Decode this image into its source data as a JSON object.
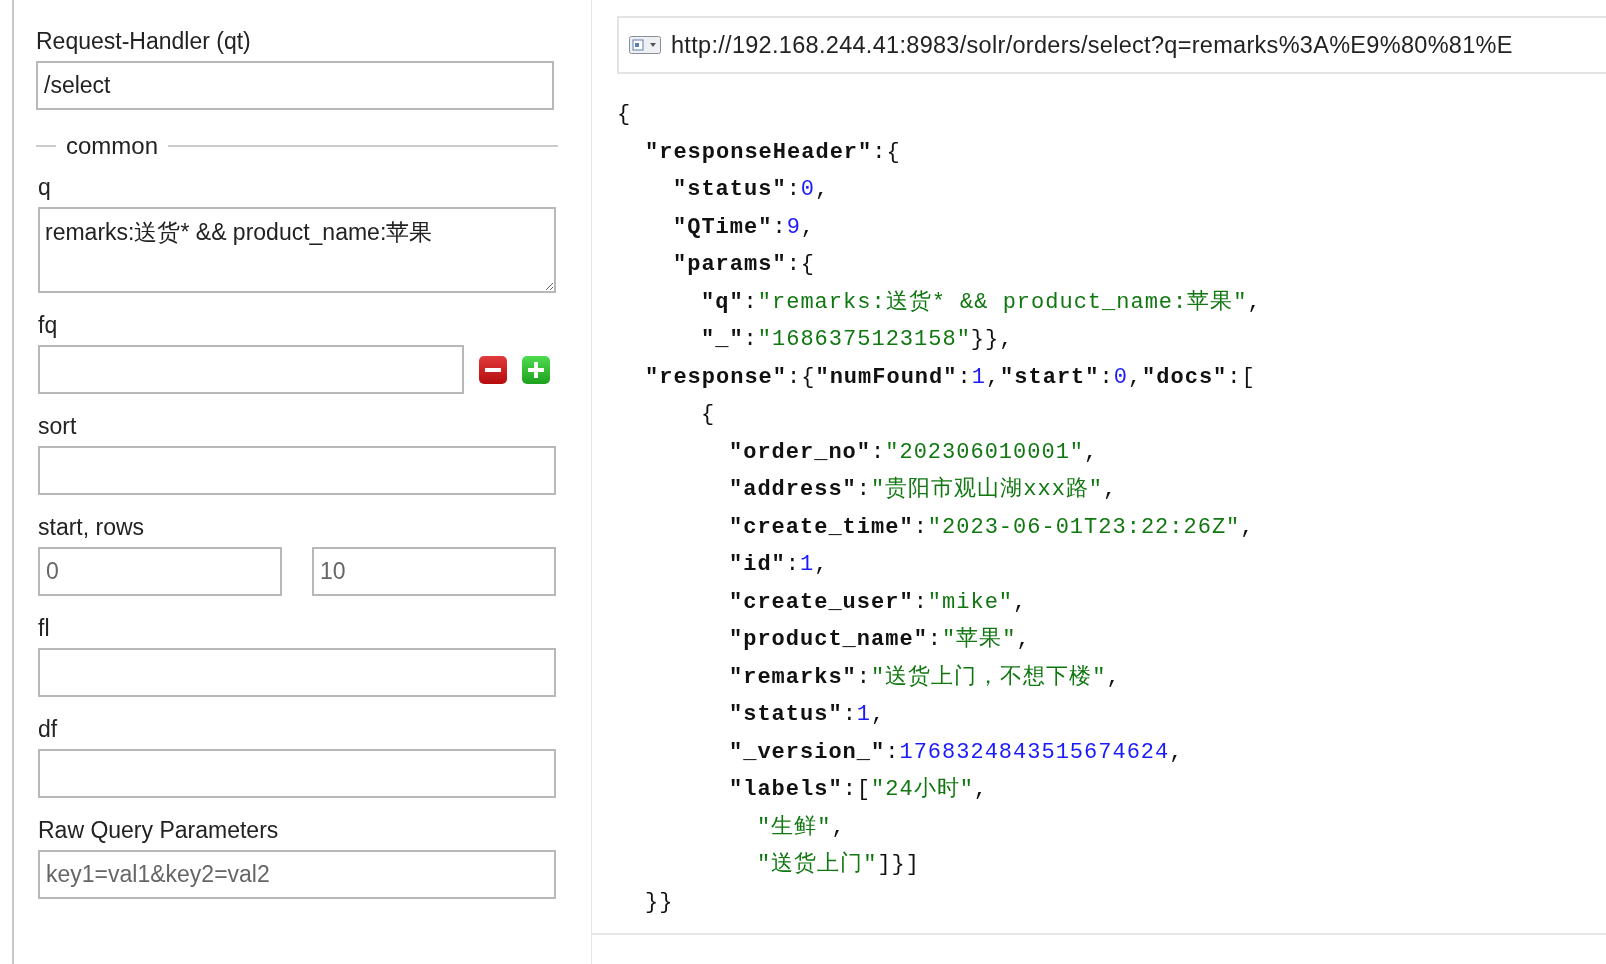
{
  "handler": {
    "label": "Request-Handler (qt)",
    "value": "/select"
  },
  "section": {
    "legend": "common"
  },
  "fields": [
    {
      "kind": "textarea",
      "label": "q",
      "value": "remarks:送货* && product_name:苹果"
    },
    {
      "kind": "filter",
      "label": "fq"
    },
    {
      "kind": "text",
      "label": "sort"
    },
    {
      "kind": "pair",
      "label": "start, rows",
      "placeholders": [
        "0",
        "10"
      ]
    },
    {
      "kind": "text",
      "label": "fl"
    },
    {
      "kind": "text",
      "label": "df"
    },
    {
      "kind": "text",
      "label": "Raw Query Parameters",
      "placeholder": "key1=val1&key2=val2"
    }
  ],
  "url_bar": {
    "url": "http://192.168.244.41:8983/solr/orders/select?q=remarks%3A%E9%80%81%E"
  },
  "response": [
    {
      "tokens": [
        {
          "kind": "punct",
          "text": "{"
        }
      ],
      "children": [
        {
          "tokens": [
            {
              "kind": "key",
              "text": "\"responseHeader\""
            },
            {
              "kind": "punct",
              "text": ":{"
            }
          ],
          "children": [
            {
              "tokens": [
                {
                  "kind": "key",
                  "text": "\"status\""
                },
                {
                  "kind": "punct",
                  "text": ":"
                },
                {
                  "kind": "number",
                  "text": "0"
                },
                {
                  "kind": "punct",
                  "text": ","
                }
              ]
            },
            {
              "tokens": [
                {
                  "kind": "key",
                  "text": "\"QTime\""
                },
                {
                  "kind": "punct",
                  "text": ":"
                },
                {
                  "kind": "number",
                  "text": "9"
                },
                {
                  "kind": "punct",
                  "text": ","
                }
              ]
            },
            {
              "tokens": [
                {
                  "kind": "key",
                  "text": "\"params\""
                },
                {
                  "kind": "punct",
                  "text": ":{"
                }
              ],
              "children": [
                {
                  "tokens": [
                    {
                      "kind": "key",
                      "text": "\"q\""
                    },
                    {
                      "kind": "punct",
                      "text": ":"
                    },
                    {
                      "kind": "string",
                      "text": "\"remarks:送货* && product_name:苹果\""
                    },
                    {
                      "kind": "punct",
                      "text": ","
                    }
                  ]
                },
                {
                  "tokens": [
                    {
                      "kind": "key",
                      "text": "\"_\""
                    },
                    {
                      "kind": "punct",
                      "text": ":"
                    },
                    {
                      "kind": "string",
                      "text": "\"1686375123158\""
                    },
                    {
                      "kind": "punct",
                      "text": "}},"
                    }
                  ]
                }
              ]
            }
          ]
        },
        {
          "tokens": [
            {
              "kind": "key",
              "text": "\"response\""
            },
            {
              "kind": "punct",
              "text": ":{"
            },
            {
              "kind": "key",
              "text": "\"numFound\""
            },
            {
              "kind": "punct",
              "text": ":"
            },
            {
              "kind": "number",
              "text": "1"
            },
            {
              "kind": "punct",
              "text": ","
            },
            {
              "kind": "key",
              "text": "\"start\""
            },
            {
              "kind": "punct",
              "text": ":"
            },
            {
              "kind": "number",
              "text": "0"
            },
            {
              "kind": "punct",
              "text": ","
            },
            {
              "kind": "key",
              "text": "\"docs\""
            },
            {
              "kind": "punct",
              "text": ":["
            }
          ],
          "children": [
            {
              "children": [
                {
                  "tokens": [
                    {
                      "kind": "punct",
                      "text": "{"
                    }
                  ],
                  "children": [
                    {
                      "tokens": [
                        {
                          "kind": "key",
                          "text": "\"order_no\""
                        },
                        {
                          "kind": "punct",
                          "text": ":"
                        },
                        {
                          "kind": "string",
                          "text": "\"202306010001\""
                        },
                        {
                          "kind": "punct",
                          "text": ","
                        }
                      ]
                    },
                    {
                      "tokens": [
                        {
                          "kind": "key",
                          "text": "\"address\""
                        },
                        {
                          "kind": "punct",
                          "text": ":"
                        },
                        {
                          "kind": "string",
                          "text": "\"贵阳市观山湖xxx路\""
                        },
                        {
                          "kind": "punct",
                          "text": ","
                        }
                      ]
                    },
                    {
                      "tokens": [
                        {
                          "kind": "key",
                          "text": "\"create_time\""
                        },
                        {
                          "kind": "punct",
                          "text": ":"
                        },
                        {
                          "kind": "string",
                          "text": "\"2023-06-01T23:22:26Z\""
                        },
                        {
                          "kind": "punct",
                          "text": ","
                        }
                      ]
                    },
                    {
                      "tokens": [
                        {
                          "kind": "key",
                          "text": "\"id\""
                        },
                        {
                          "kind": "punct",
                          "text": ":"
                        },
                        {
                          "kind": "number",
                          "text": "1"
                        },
                        {
                          "kind": "punct",
                          "text": ","
                        }
                      ]
                    },
                    {
                      "tokens": [
                        {
                          "kind": "key",
                          "text": "\"create_user\""
                        },
                        {
                          "kind": "punct",
                          "text": ":"
                        },
                        {
                          "kind": "string",
                          "text": "\"mike\""
                        },
                        {
                          "kind": "punct",
                          "text": ","
                        }
                      ]
                    },
                    {
                      "tokens": [
                        {
                          "kind": "key",
                          "text": "\"product_name\""
                        },
                        {
                          "kind": "punct",
                          "text": ":"
                        },
                        {
                          "kind": "string",
                          "text": "\"苹果\""
                        },
                        {
                          "kind": "punct",
                          "text": ","
                        }
                      ]
                    },
                    {
                      "tokens": [
                        {
                          "kind": "key",
                          "text": "\"remarks\""
                        },
                        {
                          "kind": "punct",
                          "text": ":"
                        },
                        {
                          "kind": "string",
                          "text": "\"送货上门，不想下楼\""
                        },
                        {
                          "kind": "punct",
                          "text": ","
                        }
                      ]
                    },
                    {
                      "tokens": [
                        {
                          "kind": "key",
                          "text": "\"status\""
                        },
                        {
                          "kind": "punct",
                          "text": ":"
                        },
                        {
                          "kind": "number",
                          "text": "1"
                        },
                        {
                          "kind": "punct",
                          "text": ","
                        }
                      ]
                    },
                    {
                      "tokens": [
                        {
                          "kind": "key",
                          "text": "\"_version_\""
                        },
                        {
                          "kind": "punct",
                          "text": ":"
                        },
                        {
                          "kind": "number",
                          "text": "1768324843515674624"
                        },
                        {
                          "kind": "punct",
                          "text": ","
                        }
                      ]
                    },
                    {
                      "tokens": [
                        {
                          "kind": "key",
                          "text": "\"labels\""
                        },
                        {
                          "kind": "punct",
                          "text": ":["
                        },
                        {
                          "kind": "string",
                          "text": "\"24小时\""
                        },
                        {
                          "kind": "punct",
                          "text": ","
                        }
                      ],
                      "children": [
                        {
                          "tokens": [
                            {
                              "kind": "string",
                              "text": "\"生鲜\""
                            },
                            {
                              "kind": "punct",
                              "text": ","
                            }
                          ]
                        },
                        {
                          "tokens": [
                            {
                              "kind": "string",
                              "text": "\"送货上门\""
                            },
                            {
                              "kind": "punct",
                              "text": "]}]"
                            }
                          ]
                        }
                      ]
                    }
                  ]
                }
              ]
            }
          ]
        },
        {
          "tokens": [
            {
              "kind": "punct",
              "text": "}}"
            }
          ]
        }
      ]
    }
  ]
}
